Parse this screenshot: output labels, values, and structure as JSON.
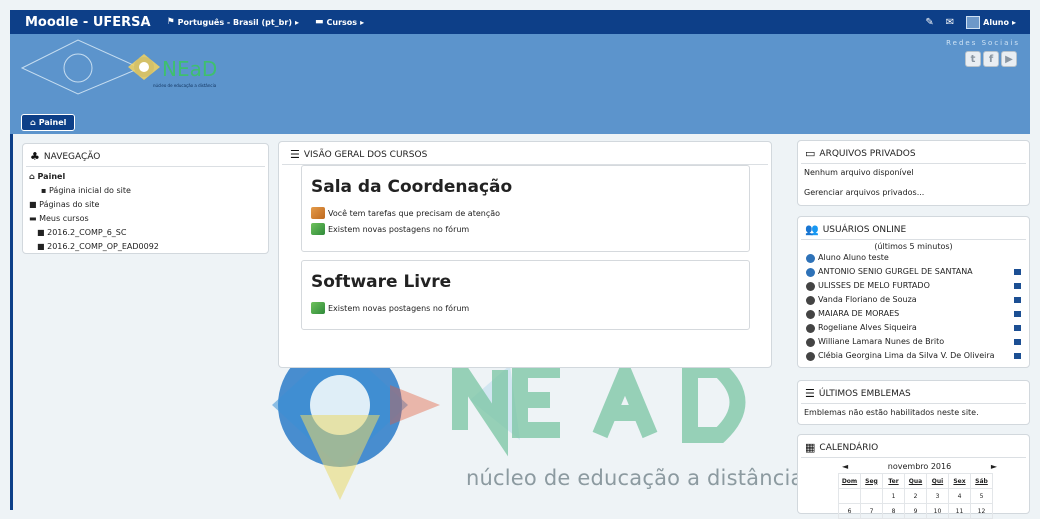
{
  "navbar": {
    "brand": "Moodle - UFERSA",
    "language": "Português - Brasil (pt_br)",
    "courses": "Cursos",
    "user": "Aluno"
  },
  "header": {
    "logo_text": "NEaD",
    "logo_subtitle": "núcleo de educação a distância",
    "social_title": "Redes Sociais"
  },
  "breadcrumb": {
    "home": "Painel"
  },
  "watermark": {
    "text": "núcleo de educação a distância"
  },
  "navigation": {
    "title": "NAVEGAÇÃO",
    "items": [
      {
        "label": "Painel"
      },
      {
        "label": "Página inicial do site"
      },
      {
        "label": "Páginas do site"
      },
      {
        "label": "Meus cursos"
      },
      {
        "label": "2016.2_COMP_6_SC"
      },
      {
        "label": "2016.2_COMP_OP_EAD0092"
      }
    ]
  },
  "overview": {
    "title": "VISÃO GERAL DOS CURSOS",
    "courses": [
      {
        "name": "Sala da Coordenação",
        "alerts": [
          "Você tem tarefas que precisam de atenção",
          "Existem novas postagens no fórum"
        ]
      },
      {
        "name": "Software Livre",
        "alerts": [
          "Existem novas postagens no fórum"
        ]
      }
    ]
  },
  "private_files": {
    "title": "ARQUIVOS PRIVADOS",
    "empty": "Nenhum arquivo disponível",
    "manage": "Gerenciar arquivos privados..."
  },
  "online_users": {
    "title": "USUÁRIOS ONLINE",
    "period": "(últimos 5 minutos)",
    "users": [
      "Aluno Aluno teste",
      "ANTONIO SENIO GURGEL DE SANTANA",
      "ULISSES DE MELO FURTADO",
      "Vanda Floriano de Souza",
      "MAIARA DE MORAES",
      "Rogeliane Alves Siqueira",
      "Williane Lamara Nunes de Brito",
      "Clébia Georgina Lima da Silva V. De Oliveira"
    ]
  },
  "badges": {
    "title": "ÚLTIMOS EMBLEMAS",
    "text": "Emblemas não estão habilitados neste site."
  },
  "calendar": {
    "title": "CALENDÁRIO",
    "month": "novembro 2016",
    "prev": "◄",
    "next": "►",
    "days": [
      "Dom",
      "Seg",
      "Ter",
      "Qua",
      "Qui",
      "Sex",
      "Sáb"
    ],
    "week1": [
      "",
      "",
      "1",
      "2",
      "3",
      "4",
      "5"
    ],
    "week2": [
      "6",
      "7",
      "8",
      "9",
      "10",
      "11",
      "12"
    ]
  }
}
